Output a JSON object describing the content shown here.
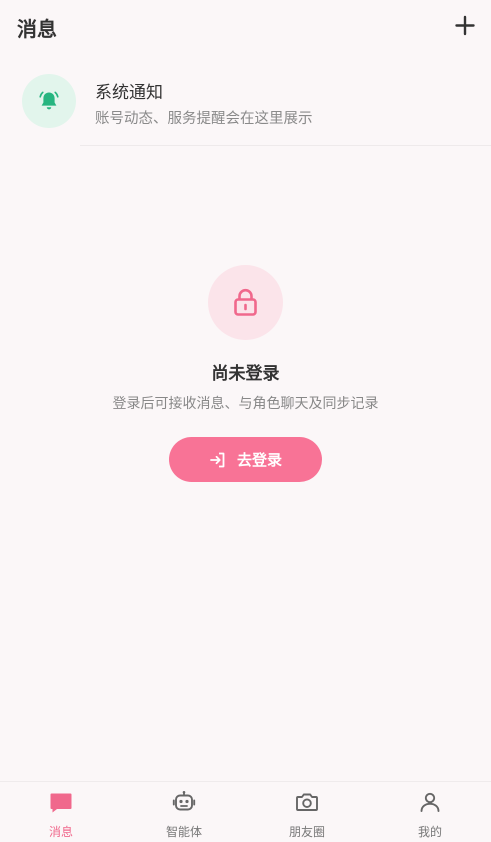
{
  "header": {
    "title": "消息",
    "add_icon": "plus-icon"
  },
  "system_notice": {
    "title": "系统通知",
    "description": "账号动态、服务提醒会在这里展示",
    "icon": "bell-icon",
    "icon_color": "#27b580",
    "icon_bg": "#e2f5ec"
  },
  "empty_state": {
    "icon": "lock-icon",
    "title": "尚未登录",
    "description": "登录后可接收消息、与角色聊天及同步记录",
    "login_button_label": "去登录",
    "login_icon": "login-icon"
  },
  "colors": {
    "accent": "#f87396",
    "accent_soft": "#fbe4ea",
    "background": "#fbf7f8"
  },
  "tabbar": {
    "tabs": [
      {
        "label": "消息",
        "icon": "chat-icon",
        "active": true
      },
      {
        "label": "智能体",
        "icon": "robot-icon",
        "active": false
      },
      {
        "label": "朋友圈",
        "icon": "camera-icon",
        "active": false
      },
      {
        "label": "我的",
        "icon": "user-icon",
        "active": false
      }
    ]
  }
}
